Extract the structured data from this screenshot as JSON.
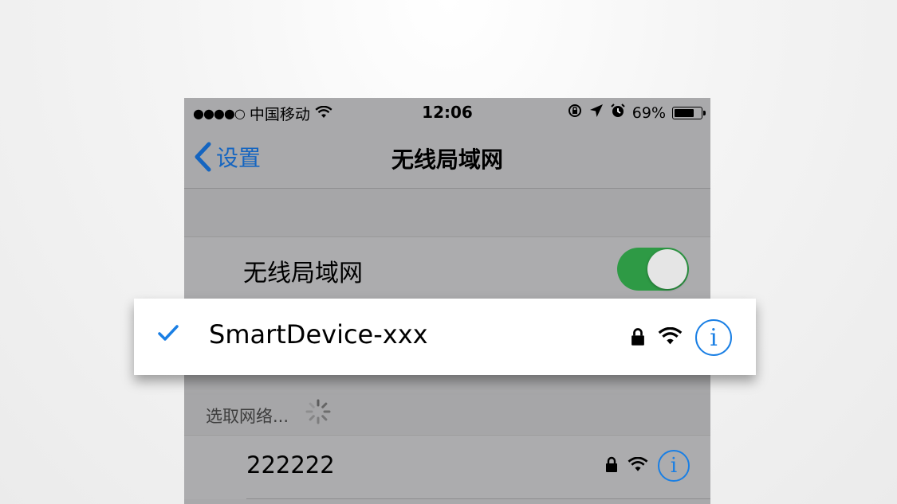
{
  "status_bar": {
    "signal_dots": "●●●●○",
    "carrier": "中国移动",
    "time": "12:06",
    "battery_percent": "69%",
    "icons": [
      "wifi-icon",
      "rotation-lock-icon",
      "location-arrow-icon",
      "alarm-icon",
      "battery-icon"
    ]
  },
  "nav_bar": {
    "back_label": "设置",
    "title": "无线局域网"
  },
  "wlan_toggle": {
    "label": "无线局域网",
    "enabled": true,
    "accent_color": "#2e9a45"
  },
  "connected_network": {
    "name": "SmartDevice-xxx",
    "connected": true,
    "secured": true,
    "info_label": "i",
    "icons": [
      "checkmark-icon",
      "lock-icon",
      "wifi-signal-icon",
      "info-icon"
    ],
    "accent_color": "#1a7fe4"
  },
  "choose_network": {
    "header": "选取网络...",
    "loading": true
  },
  "networks": [
    {
      "name": "222222",
      "secured": true,
      "info_label": "i"
    }
  ]
}
